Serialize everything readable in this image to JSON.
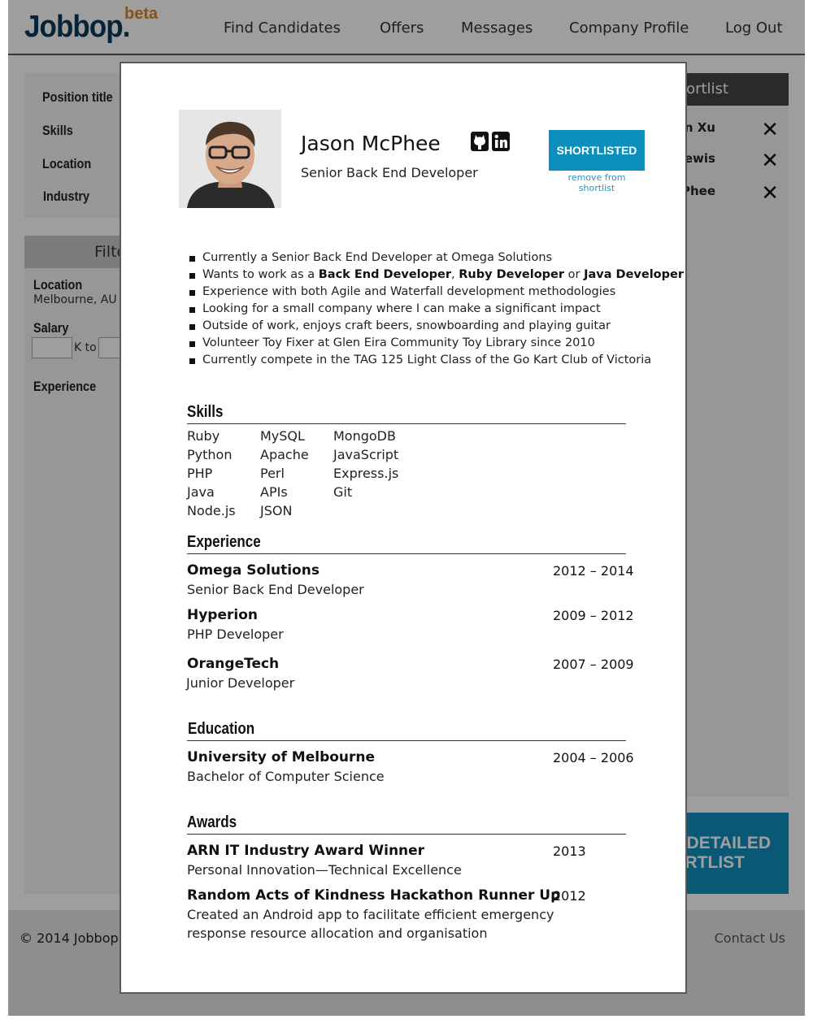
{
  "brand": {
    "logo": "Jobbop.",
    "beta": "beta",
    "logo_color": "#0a3a57",
    "beta_color": "#d8842a"
  },
  "nav": {
    "items": [
      {
        "label": "Find Candidates"
      },
      {
        "label": "Offers"
      },
      {
        "label": "Messages"
      },
      {
        "label": "Company Profile"
      },
      {
        "label": "Log Out"
      }
    ]
  },
  "search_filters": {
    "position_title": "Position title",
    "skills": "Skills",
    "location": "Location",
    "industry": "Industry"
  },
  "filter_panel": {
    "title": "Filte",
    "location_label": "Location",
    "location_value": "Melbourne, AU",
    "salary_label": "Salary",
    "salary_to": "K to",
    "experience_label": "Experience"
  },
  "shortlist": {
    "title": "ortlist",
    "items": [
      {
        "name": "n Xu"
      },
      {
        "name": "Lewis"
      },
      {
        "name": "McPhee"
      }
    ],
    "remove_icon": "close-icon",
    "detailed_line1": "DETAILED",
    "detailed_line2": "RTLIST"
  },
  "footer": {
    "copyright": "© 2014 Jobbop.",
    "contact": "Contact Us"
  },
  "modal": {
    "name": "Jason McPhee",
    "title": "Senior Back End Developer",
    "social": [
      "github-icon",
      "linkedin-icon"
    ],
    "shortlisted_label": "SHORTLISTED",
    "remove_label": "remove from shortlist",
    "accent": "#0d8fbe",
    "highlights": {
      "b0": "Currently a Senior Back End Developer at Omega Solutions",
      "b1_pre": "Wants to work as a ",
      "b1_r1": "Back End Developer",
      "b1_sep1": ", ",
      "b1_r2": "Ruby Developer",
      "b1_sep2": " or ",
      "b1_r3": "Java Developer",
      "b2": "Experience with both Agile and Waterfall development methodologies",
      "b3": "Looking for a small company where I can make a significant impact",
      "b4": "Outside of work, enjoys craft beers, snowboarding and playing guitar",
      "b5": "Volunteer Toy Fixer at Glen Eira Community Toy Library since 2010",
      "b6": "Currently compete in the TAG 125 Light Class of the Go Kart Club of Victoria"
    },
    "skills_title": "Skills",
    "skills": [
      [
        "Ruby",
        "Python",
        "PHP",
        "Java",
        "Node.js"
      ],
      [
        "MySQL",
        "Apache",
        "Perl",
        "APIs",
        "JSON"
      ],
      [
        "MongoDB",
        "JavaScript",
        "Express.js",
        "Git"
      ]
    ],
    "experience_title": "Experience",
    "experience": [
      {
        "company": "Omega Solutions",
        "role": "Senior Back End Developer",
        "dates": "2012 – 2014"
      },
      {
        "company": "Hyperion",
        "role": "PHP Developer",
        "dates": "2009 – 2012"
      },
      {
        "company": "OrangeTech",
        "role": "Junior Developer",
        "dates": "2007 – 2009"
      }
    ],
    "education_title": "Education",
    "education": [
      {
        "school": "University of Melbourne",
        "degree": "Bachelor of Computer Science",
        "dates": "2004 – 2006"
      }
    ],
    "awards_title": "Awards",
    "awards": [
      {
        "name": "ARN IT Industry Award Winner",
        "desc_l1": "Personal Innovation—Technical Excellence",
        "desc_l2": "",
        "year": "2013"
      },
      {
        "name": "Random Acts of Kindness Hackathon Runner Up",
        "desc_l1": "Created an Android app to facilitate efficient emergency",
        "desc_l2": "response resource allocation and organisation",
        "year": "2012"
      }
    ]
  }
}
